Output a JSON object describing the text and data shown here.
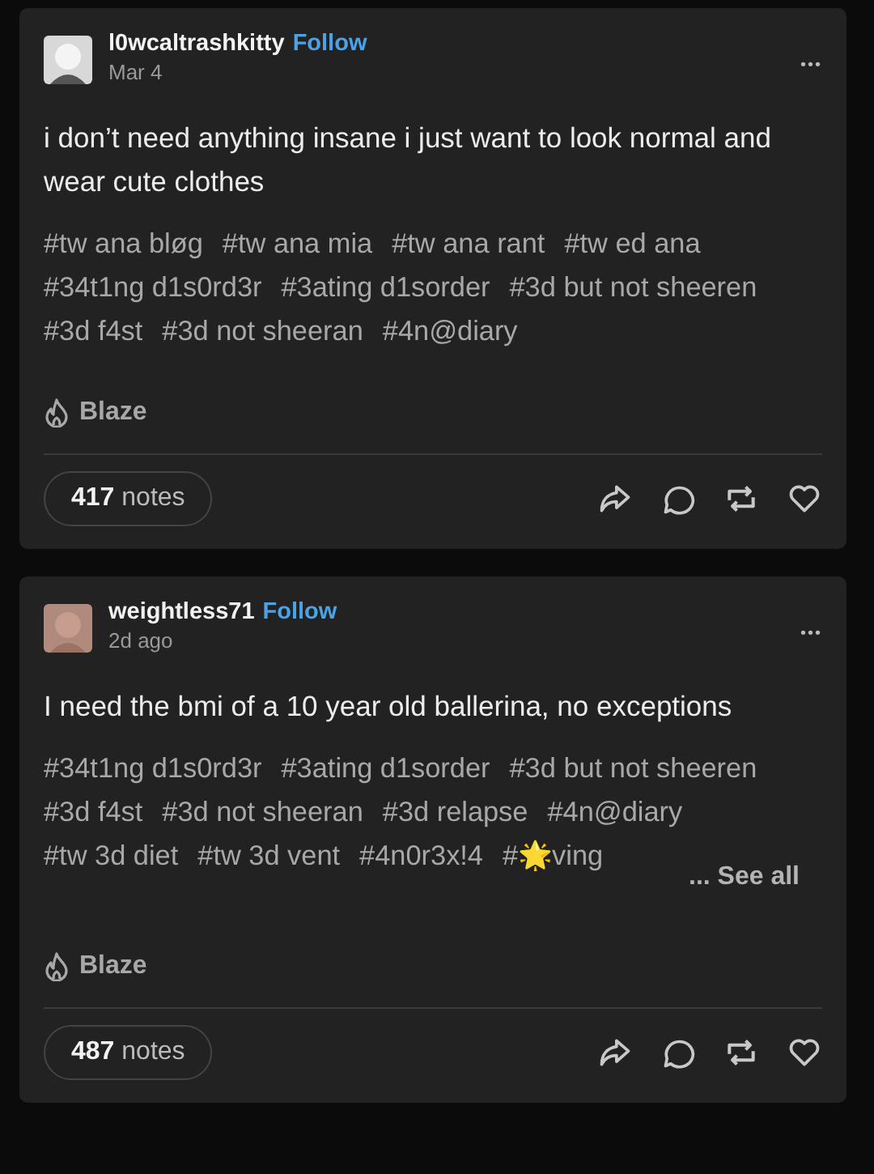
{
  "posts": [
    {
      "username": "l0wcaltrashkitty",
      "follow": "Follow",
      "date": "Mar 4",
      "menu": "•••",
      "body": "i don’t need anything insane i just want to look normal and wear cute clothes",
      "tags": [
        "#tw ana bløg",
        "#tw ana mia",
        "#tw ana rant",
        "#tw ed ana",
        "#34t1ng d1s0rd3r",
        "#3ating d1sorder",
        "#3d but not sheeren",
        "#3d f4st",
        "#3d not sheeran",
        "#4n@diary"
      ],
      "blaze": "Blaze",
      "notes_count": "417",
      "notes_label": "notes"
    },
    {
      "username": "weightless71",
      "follow": "Follow",
      "date": "2d ago",
      "menu": "•••",
      "body": "I need the bmi of a 10 year old ballerina, no exceptions",
      "tags": [
        "#34t1ng d1s0rd3r",
        "#3ating d1sorder",
        "#3d but not sheeren",
        "#3d f4st",
        "#3d not sheeran",
        "#3d relapse",
        "#4n@diary",
        "#tw 3d diet",
        "#tw 3d vent",
        "#4n0r3x!4",
        "#🌟ving"
      ],
      "see_all": "... See all",
      "blaze": "Blaze",
      "notes_count": "487",
      "notes_label": "notes"
    }
  ]
}
